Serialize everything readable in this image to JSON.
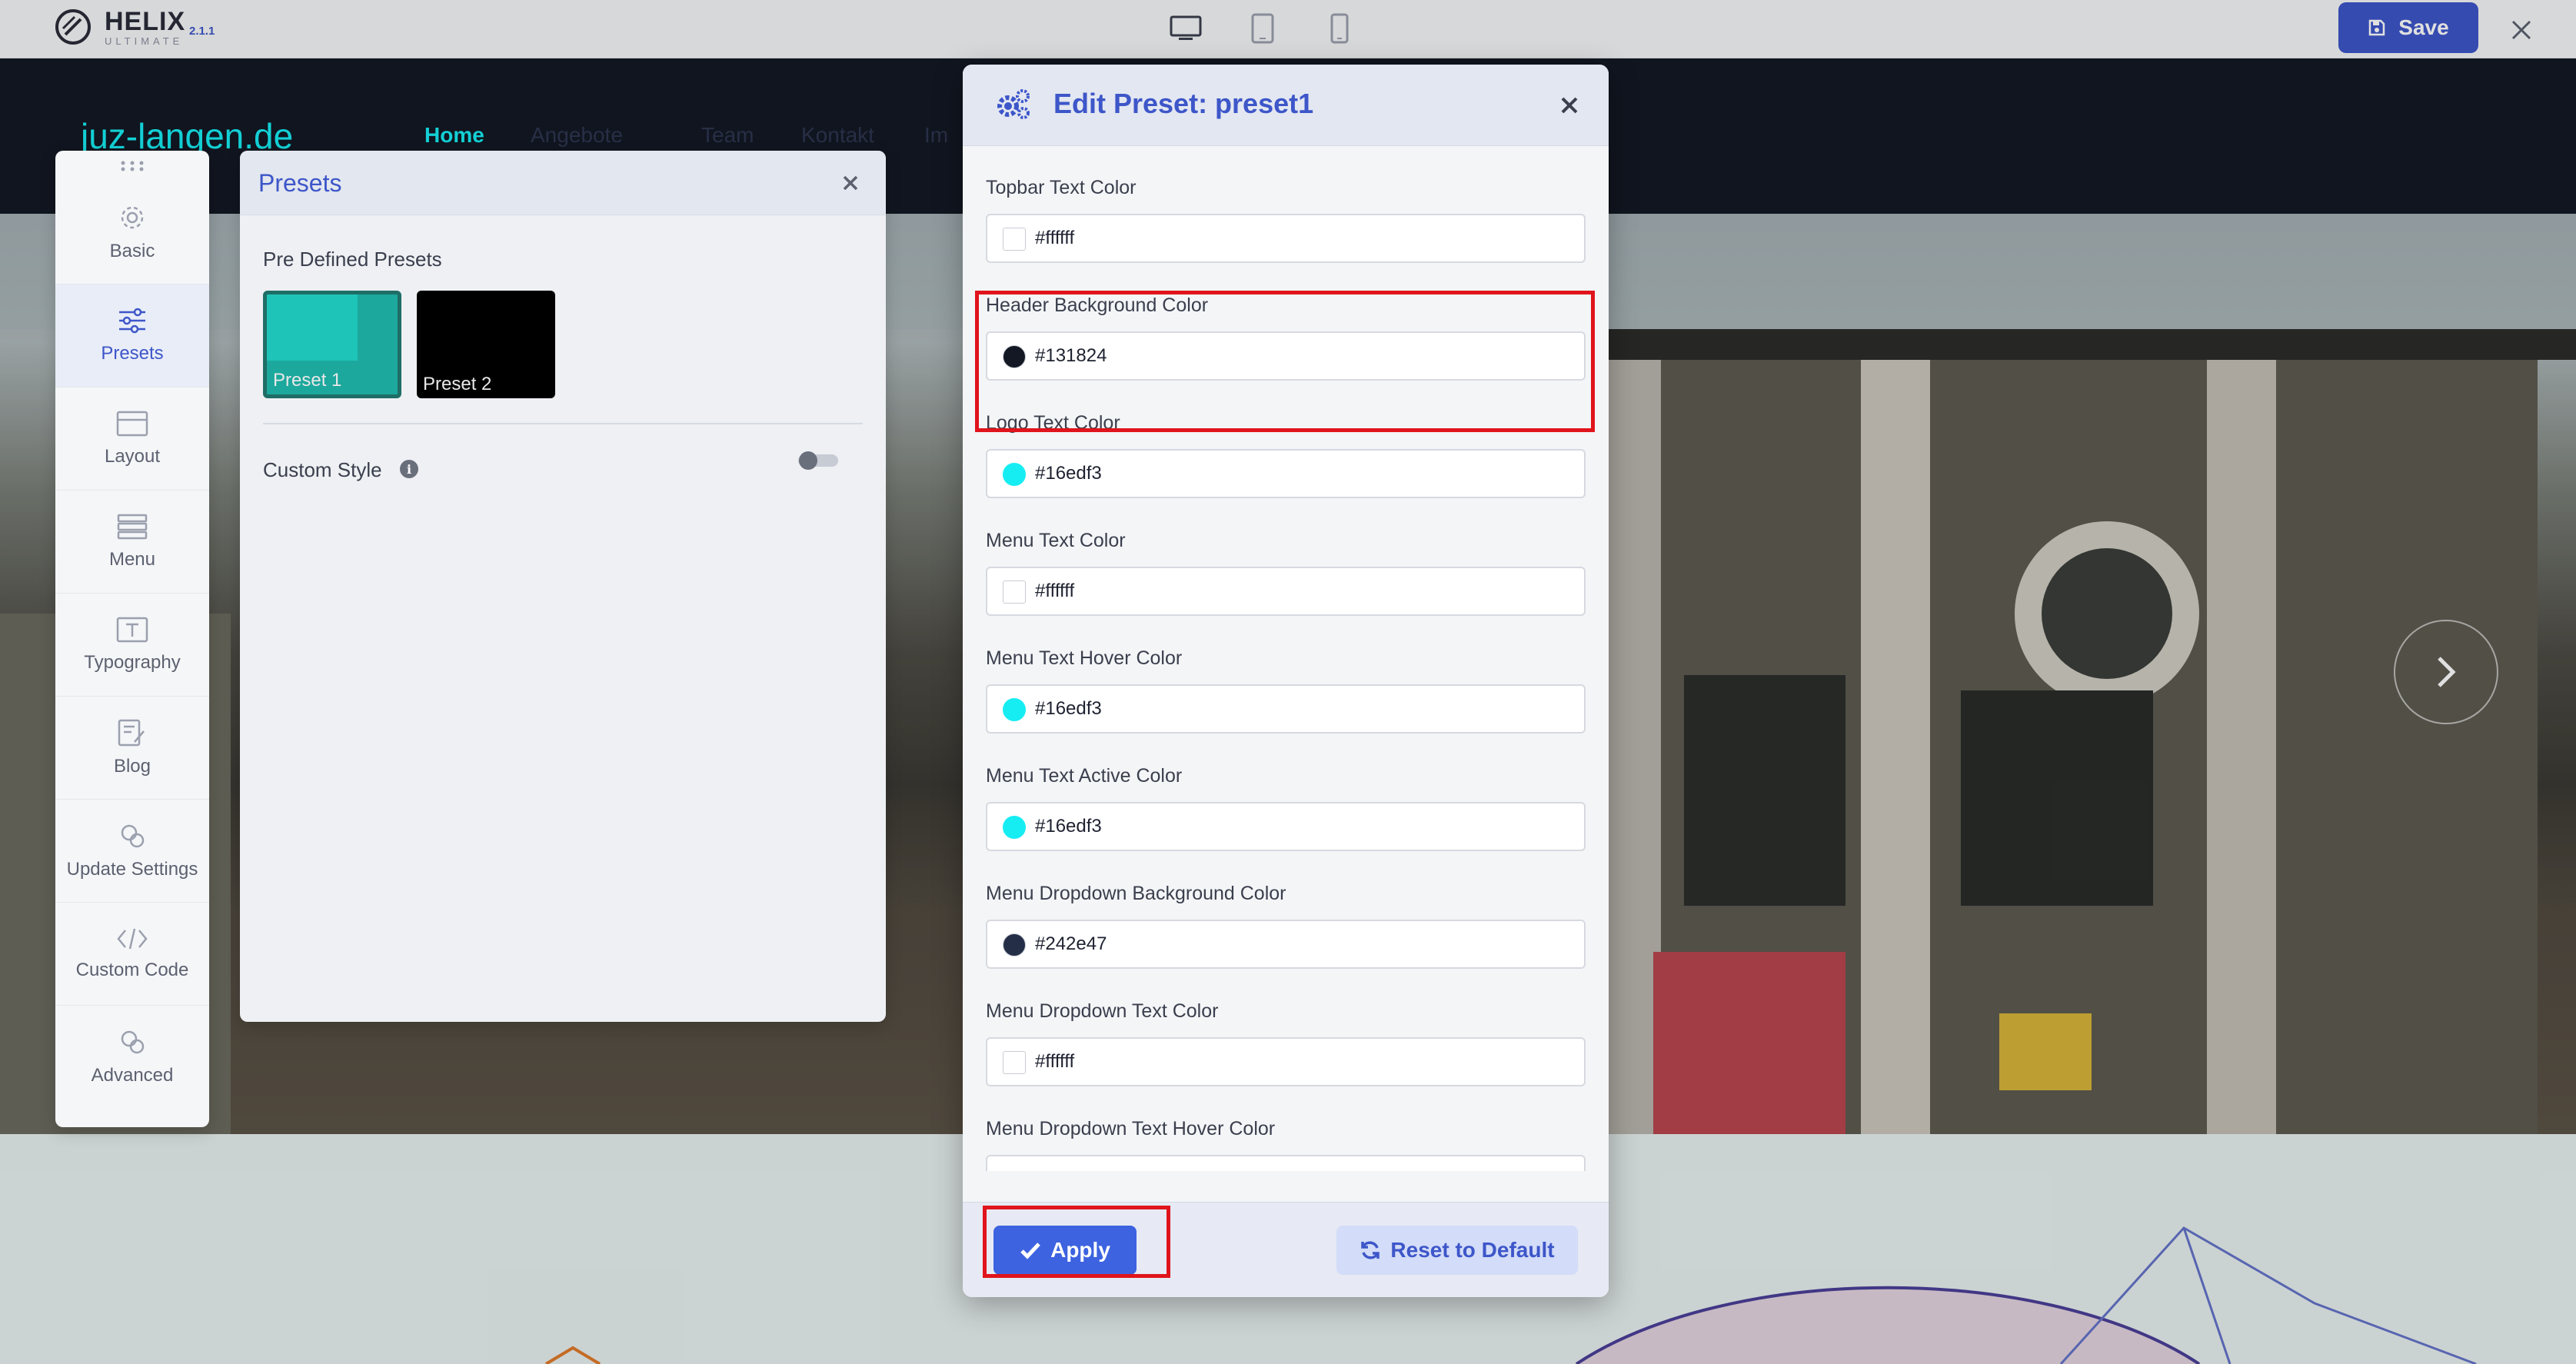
{
  "topbar": {
    "brand_name": "HELIX",
    "brand_sub": "ULTIMATE",
    "version": "2.1.1",
    "device_icons": [
      "desktop-icon",
      "tablet-icon",
      "mobile-icon"
    ],
    "save_label": "Save",
    "accent": "#3d56c9"
  },
  "site": {
    "logo_text": "juz-langen.de",
    "menu": [
      "Home",
      "Angebote",
      "Team",
      "Kontakt",
      "Im"
    ],
    "header_bg": "#131824",
    "accent": "#16edf3"
  },
  "sidebar": {
    "items": [
      {
        "label": "Basic",
        "icon": "gear-icon"
      },
      {
        "label": "Presets",
        "icon": "sliders-icon",
        "active": true
      },
      {
        "label": "Layout",
        "icon": "layout-icon"
      },
      {
        "label": "Menu",
        "icon": "menu-icon"
      },
      {
        "label": "Typography",
        "icon": "typography-icon"
      },
      {
        "label": "Blog",
        "icon": "blog-icon"
      },
      {
        "label": "Update Settings",
        "icon": "update-settings-icon"
      },
      {
        "label": "Custom Code",
        "icon": "code-icon"
      },
      {
        "label": "Advanced",
        "icon": "advanced-icon"
      }
    ]
  },
  "presets_panel": {
    "title": "Presets",
    "predefined_label": "Pre Defined Presets",
    "presets": [
      {
        "label": "Preset 1",
        "color": "#1fc4b8"
      },
      {
        "label": "Preset 2",
        "color": "#000000"
      }
    ],
    "custom_style_label": "Custom Style",
    "custom_style_enabled": false
  },
  "modal": {
    "title": "Edit Preset: preset1",
    "fields": [
      {
        "label": "Topbar Text Color",
        "value": "#ffffff"
      },
      {
        "label": "Header Background Color",
        "value": "#131824"
      },
      {
        "label": "Logo Text Color",
        "value": "#16edf3"
      },
      {
        "label": "Menu Text Color",
        "value": "#ffffff"
      },
      {
        "label": "Menu Text Hover Color",
        "value": "#16edf3"
      },
      {
        "label": "Menu Text Active Color",
        "value": "#16edf3"
      },
      {
        "label": "Menu Dropdown Background Color",
        "value": "#242e47"
      },
      {
        "label": "Menu Dropdown Text Color",
        "value": "#ffffff"
      },
      {
        "label": "Menu Dropdown Text Hover Color",
        "value": ""
      }
    ],
    "apply_label": "Apply",
    "reset_label": "Reset to Default"
  }
}
